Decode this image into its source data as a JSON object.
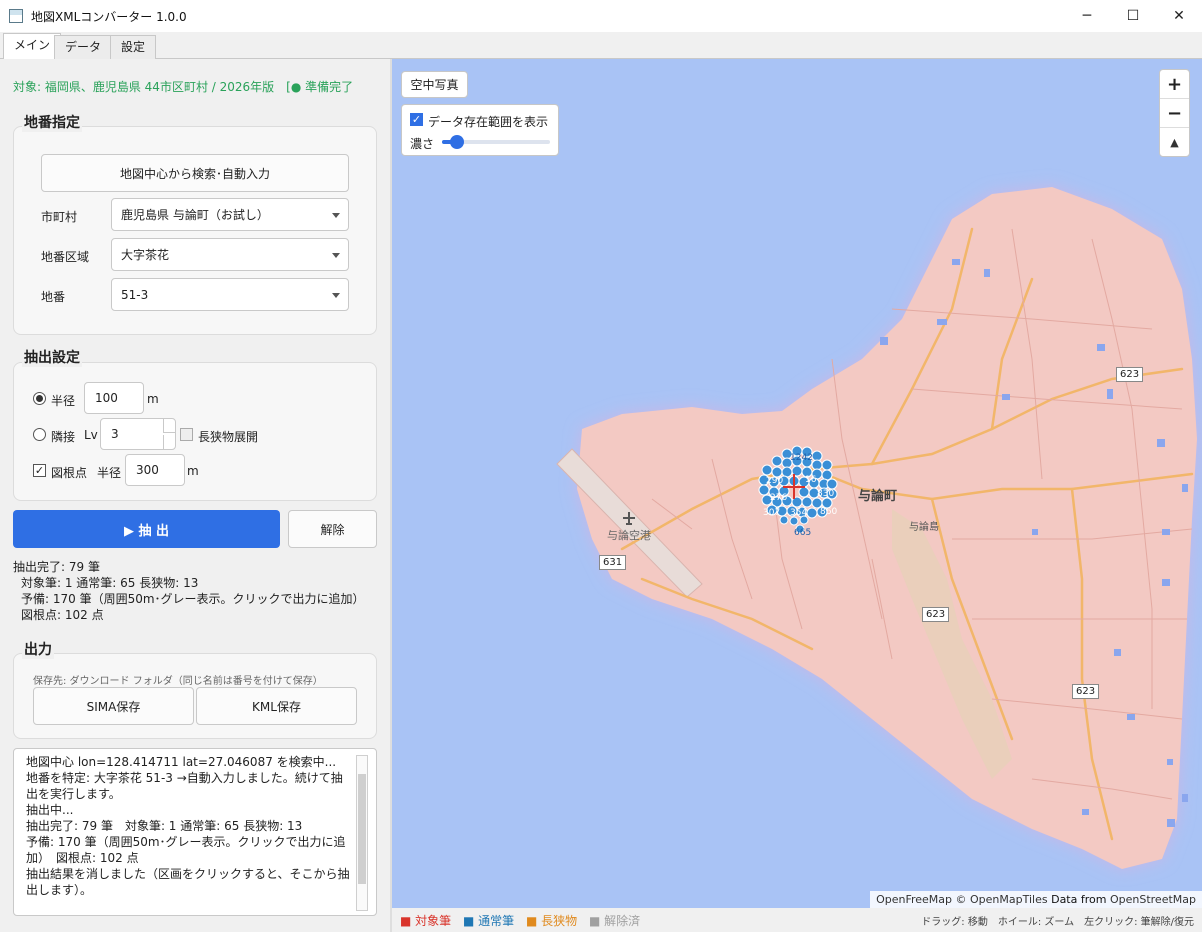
{
  "window": {
    "title": "地図XMLコンバーター 1.0.0",
    "minimize": "─",
    "maximize": "☐",
    "close": "✕"
  },
  "tabs": [
    {
      "label": "メイン"
    },
    {
      "label": "データ"
    },
    {
      "label": "設定"
    }
  ],
  "status_line": "対象: 福岡県、鹿児島県 44市区町村 / 2026年版　[● 準備完了",
  "parcel": {
    "title": "地番指定",
    "search_button": "地図中心から検索･自動入力",
    "municipality_label": "市町村",
    "municipality_value": "鹿児島県 与論町（お試し）",
    "area_label": "地番区域",
    "area_value": "大字茶花",
    "lot_label": "地番",
    "lot_value": "51-3"
  },
  "extract": {
    "title": "抽出設定",
    "radius_label": "半径",
    "radius_value": "100",
    "radius_unit": "m",
    "adjacent_label": "隣接",
    "lv_label": "Lv",
    "lv_value": "3",
    "long_label": "長狭物展開",
    "point_label": "図根点",
    "point_radius_label": "半径",
    "point_radius_value": "300",
    "point_unit": "m"
  },
  "actions": {
    "extract_label": "▶ 抽 出",
    "clear_label": "解除"
  },
  "result": {
    "line1": "抽出完了: 79 筆",
    "line2": "対象筆: 1  通常筆: 65  長狭物: 13",
    "line3": "予備: 170 筆（周囲50m･グレー表示。クリックで出力に追加）",
    "line4": "図根点: 102 点"
  },
  "output": {
    "title": "出力",
    "save_path": "保存先: ダウンロード フォルダ（同じ名前は番号を付けて保存）",
    "sima_button": "SIMA保存",
    "kml_button": "KML保存"
  },
  "log": [
    "地図中心 lon=128.414711 lat=27.046087 を検索中...",
    "地番を特定: 大字茶花 51-3 →自動入力しました。続けて抽出を実行します。",
    "抽出中...",
    "抽出完了: 79 筆　対象筆: 1  通常筆: 65  長狭物: 13",
    "予備: 170 筆（周囲50m･グレー表示。クリックで出力に追加）　図根点: 102 点",
    "抽出結果を消しました（区画をクリックすると、そこから抽出します）。"
  ],
  "map": {
    "aerial_button": "空中写真",
    "show_range_label": "データ存在範囲を表示",
    "opacity_label": "濃さ",
    "opacity_value": 0.12,
    "zoom_in": "+",
    "zoom_out": "−",
    "compass": "▲",
    "town_label": "与論町",
    "island_label": "与論島",
    "airport_label": "与論空港",
    "road_631": "631",
    "road_623a": "623",
    "road_623b": "623",
    "road_623c": "623",
    "cluster_labels": [
      "1242",
      "290",
      "16",
      "830",
      "276",
      "860",
      "307",
      "354",
      "665"
    ],
    "attribution_osm": "OpenFreeMap © OpenMapTiles",
    "attribution_data": "Data from",
    "attribution_source": "OpenStreetMap",
    "colors": {
      "sea": "#a9c3f5",
      "land": "#f3c9c3",
      "road": "#f2b66a",
      "parcel": "#3a8fd6"
    }
  },
  "legend": {
    "target": "■ 対象筆",
    "normal": "■ 通常筆",
    "long": "■ 長狭物",
    "released": "■ 解除済",
    "target_color": "#d9342b",
    "normal_color": "#1f77b4",
    "long_color": "#e08a1e",
    "released_color": "#a0a0a0"
  },
  "hint": "ドラッグ: 移動　ホイール: ズーム　左クリック: 筆解除/復元"
}
